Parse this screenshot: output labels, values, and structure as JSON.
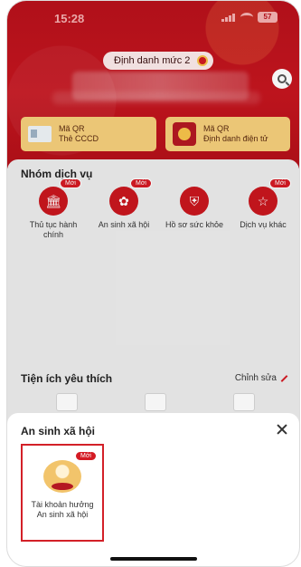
{
  "status_bar": {
    "time": "15:28",
    "battery": "57"
  },
  "header": {
    "level_label": "Định danh mức 2",
    "qr_cards": [
      {
        "title": "Mã QR",
        "subtitle": "Thẻ CCCD"
      },
      {
        "title": "Mã QR",
        "subtitle": "Định danh điện tử"
      }
    ]
  },
  "services": {
    "title": "Nhóm dịch vụ",
    "items": [
      {
        "label": "Thủ tục hành chính",
        "badge": "Mới",
        "icon": "bank-icon"
      },
      {
        "label": "An sinh xã hội",
        "badge": "Mới",
        "icon": "social-security-icon"
      },
      {
        "label": "Hồ sơ sức khỏe",
        "badge": "",
        "icon": "health-record-icon"
      },
      {
        "label": "Dịch vụ khác",
        "badge": "Mới",
        "icon": "other-services-icon"
      }
    ]
  },
  "favorites": {
    "title": "Tiện ích yêu thích",
    "edit_label": "Chỉnh sửa"
  },
  "sheet": {
    "title": "An sinh xã hội",
    "items": [
      {
        "label": "Tài khoản hưởng An sinh xã hội",
        "badge": "Mới",
        "icon": "social-account-icon"
      }
    ]
  },
  "colors": {
    "brand_red": "#c5151f",
    "gold": "#f5cf7b",
    "highlight_border": "#d32028"
  }
}
